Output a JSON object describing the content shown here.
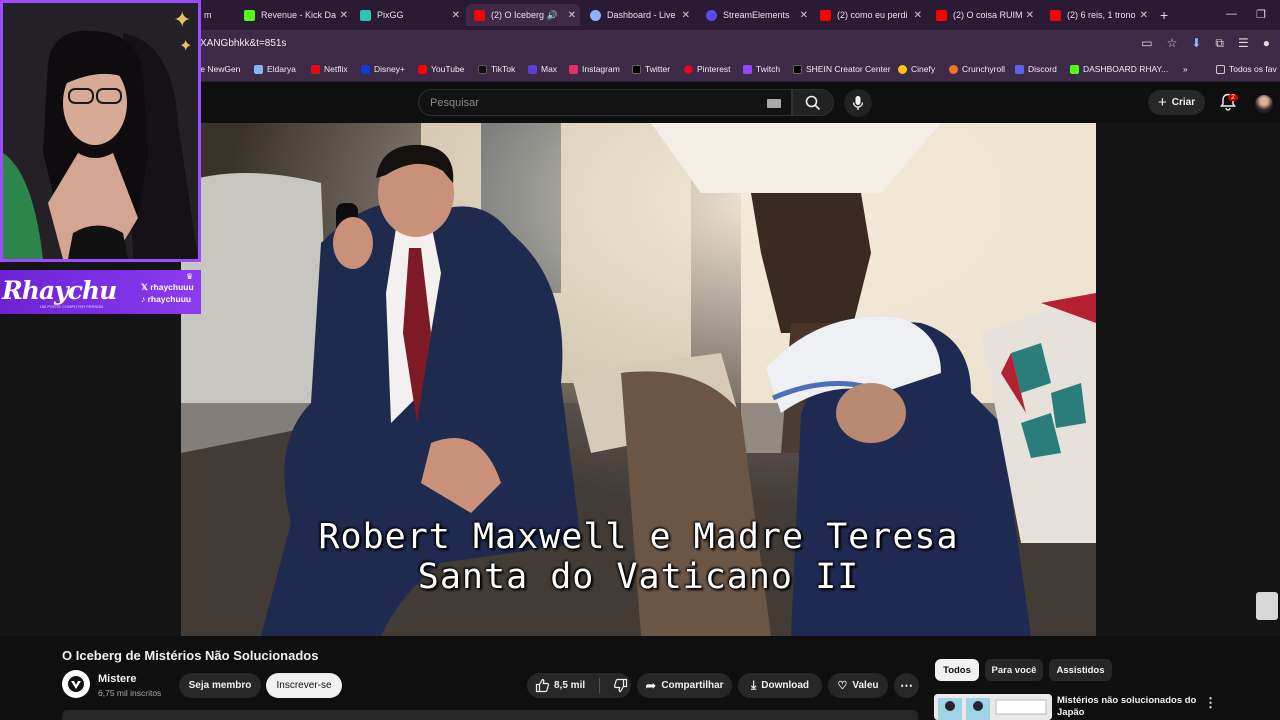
{
  "browser": {
    "tabs": [
      {
        "label": "m",
        "active": false
      },
      {
        "label": "Revenue - Kick Da",
        "active": false
      },
      {
        "label": "PixGG",
        "active": false
      },
      {
        "label": "(2) O Iceberg",
        "active": true
      },
      {
        "label": "Dashboard - Live",
        "active": false
      },
      {
        "label": "StreamElements",
        "active": false
      },
      {
        "label": "(2) como eu perdi",
        "active": false
      },
      {
        "label": "(2) O coisa RUIM",
        "active": false
      },
      {
        "label": "(2) 6 reis, 1 trono",
        "active": false
      }
    ],
    "url": "XANGbhkk&t=851s",
    "bookmarks": [
      {
        "label": "ce NewGen",
        "color": "#7a7a7a"
      },
      {
        "label": "Eldarya",
        "color": "#8ab4f8"
      },
      {
        "label": "Netflix",
        "color": "#e50914"
      },
      {
        "label": "Disney+",
        "color": "#113ccf"
      },
      {
        "label": "YouTube",
        "color": "#ff0000"
      },
      {
        "label": "TikTok",
        "color": "#111111"
      },
      {
        "label": "Max",
        "color": "#5b3fd6"
      },
      {
        "label": "Instagram",
        "color": "#e1306c"
      },
      {
        "label": "Twitter",
        "color": "#000000"
      },
      {
        "label": "Pinterest",
        "color": "#e60023"
      },
      {
        "label": "Twitch",
        "color": "#9146ff"
      },
      {
        "label": "SHEIN Creator Center",
        "color": "#000000"
      },
      {
        "label": "Cinefy",
        "color": "#f5c518"
      },
      {
        "label": "Crunchyroll",
        "color": "#f47521"
      },
      {
        "label": "Discord",
        "color": "#5865f2"
      },
      {
        "label": "DASHBOARD RHAY...",
        "color": "#53fc18"
      }
    ],
    "other_bookmarks": "Todos os fav"
  },
  "youtube": {
    "search_placeholder": "Pesquisar",
    "create_label": "Criar",
    "notification_count": "2"
  },
  "video": {
    "caption_line1": "Robert Maxwell e Madre Teresa",
    "caption_line2": "Santa do Vaticano II"
  },
  "overlay": {
    "streamer_name": "Rhaychu",
    "streamer_tagline": "UM PORTE COMPUTER PERSON",
    "handle_x": "rhaychuuu",
    "handle_tiktok": "rhaychuuu"
  },
  "details": {
    "title": "O Iceberg de Mistérios Não Solucionados",
    "channel": "Mistere",
    "subscribers": "6,75 mil inscritos",
    "join_label": "Seja membro",
    "subscribe_label": "Inscrever-se",
    "likes": "8,5 mil",
    "share_label": "Compartilhar",
    "download_label": "Download",
    "thanks_label": "Valeu"
  },
  "sidebar": {
    "chips": [
      "Todos",
      "Para você",
      "Assistidos"
    ],
    "rec_title": "Mistérios não solucionados do Japão"
  },
  "colors": {
    "accent_purple": "#9b4dff",
    "youtube_red": "#cc0000"
  }
}
